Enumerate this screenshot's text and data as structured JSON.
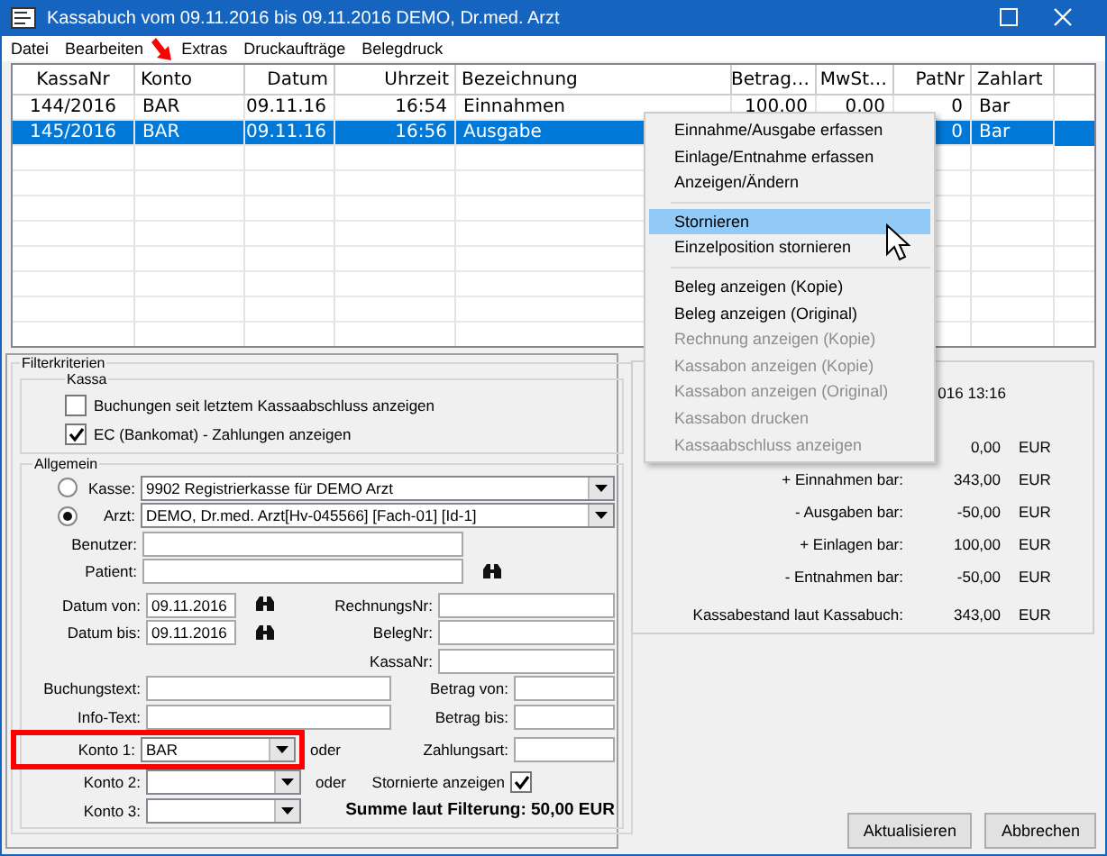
{
  "window": {
    "title": "Kassabuch vom 09.11.2016 bis 09.11.2016 DEMO, Dr.med. Arzt"
  },
  "menu": [
    "Datei",
    "Bearbeiten",
    "Extras",
    "Druckaufträge",
    "Belegdruck"
  ],
  "table": {
    "columns": [
      "KassaNr",
      "Konto",
      "Datum",
      "Uhrzeit",
      "Bezeichnung",
      "Betrag…",
      "MwSt…",
      "PatNr",
      "Zahlart"
    ],
    "rows": [
      {
        "selected": false,
        "cells": [
          "144/2016",
          "BAR",
          "09.11.16",
          "16:54",
          "Einnahmen",
          "100,00",
          "0,00",
          "0",
          "Bar"
        ]
      },
      {
        "selected": true,
        "cells": [
          "145/2016",
          "BAR",
          "09.11.16",
          "16:56",
          "Ausgabe",
          null,
          null,
          "0",
          "Bar"
        ]
      }
    ]
  },
  "context_menu": {
    "groups": [
      [
        {
          "label": "Einnahme/Ausgabe erfassen",
          "disabled": false,
          "selected": false
        },
        {
          "label": "Einlage/Entnahme erfassen",
          "disabled": false,
          "selected": false
        },
        {
          "label": "Anzeigen/Ändern",
          "disabled": false,
          "selected": false
        }
      ],
      [
        {
          "label": "Stornieren",
          "disabled": false,
          "selected": true
        },
        {
          "label": "Einzelposition stornieren",
          "disabled": false,
          "selected": false
        }
      ],
      [
        {
          "label": "Beleg anzeigen (Kopie)",
          "disabled": false,
          "selected": false
        },
        {
          "label": "Beleg anzeigen (Original)",
          "disabled": false,
          "selected": false
        },
        {
          "label": "Rechnung anzeigen (Kopie)",
          "disabled": true,
          "selected": false
        },
        {
          "label": "Kassabon anzeigen (Kopie)",
          "disabled": true,
          "selected": false
        },
        {
          "label": "Kassabon anzeigen (Original)",
          "disabled": true,
          "selected": false
        },
        {
          "label": "Kassabon drucken",
          "disabled": true,
          "selected": false
        },
        {
          "label": "Kassaabschluss anzeigen",
          "disabled": true,
          "selected": false
        }
      ]
    ]
  },
  "filter": {
    "title": "Filterkriterien",
    "kassa": {
      "title": "Kassa",
      "options": [
        {
          "label": "Buchungen seit letztem Kassaabschluss anzeigen",
          "checked": false
        },
        {
          "label": "EC (Bankomat) - Zahlungen anzeigen",
          "checked": true
        }
      ]
    },
    "allgemein": {
      "title": "Allgemein",
      "sources": [
        {
          "label": "Kasse:",
          "value": "9902  Registrierkasse für DEMO Arzt",
          "selected": false
        },
        {
          "label": "Arzt:",
          "value": "DEMO, Dr.med. Arzt[Hv-045566] [Fach-01] [Id-1]",
          "selected": true
        }
      ],
      "benutzer": {
        "label": "Benutzer:"
      },
      "patient": {
        "label": "Patient:"
      },
      "left": [
        {
          "kind": "date",
          "label": "Datum von:",
          "value": "09.11.2016"
        },
        {
          "kind": "date",
          "label": "Datum bis:",
          "value": "09.11.2016"
        },
        {
          "kind": "empty"
        },
        {
          "kind": "text",
          "label": "Buchungstext:"
        },
        {
          "kind": "text",
          "label": "Info-Text:"
        },
        {
          "kind": "combo",
          "label": "Konto 1:",
          "value": "BAR",
          "suffix": "oder",
          "highlighted": true
        },
        {
          "kind": "combo",
          "label": "Konto 2:",
          "suffix": "oder",
          "highlighted": false
        },
        {
          "kind": "combo",
          "label": "Konto 3:",
          "highlighted": false
        }
      ],
      "right": [
        {
          "kind": "wide",
          "label": "RechnungsNr:"
        },
        {
          "kind": "wide",
          "label": "BelegNr:"
        },
        {
          "kind": "wide",
          "label": "KassaNr:"
        },
        {
          "kind": "narrow",
          "label": "Betrag von:"
        },
        {
          "kind": "narrow",
          "label": "Betrag bis:"
        },
        {
          "kind": "narrow",
          "label": "Zahlungsart:"
        },
        {
          "kind": "check",
          "label": "Stornierte anzeigen",
          "checked": true
        },
        {
          "kind": "total",
          "label": "Summe laut Filterung: 50,00 EUR"
        }
      ]
    }
  },
  "summary": {
    "header": "016 13:16",
    "rows": [
      {
        "amount": "0,00",
        "unit": "EUR"
      },
      {
        "label": "+ Einnahmen bar:",
        "amount": "343,00",
        "unit": "EUR"
      },
      {
        "label": "- Ausgaben bar:",
        "amount": "-50,00",
        "unit": "EUR"
      },
      {
        "label": "+ Einlagen bar:",
        "amount": "100,00",
        "unit": "EUR"
      },
      {
        "label": "- Entnahmen bar:",
        "amount": "-50,00",
        "unit": "EUR"
      },
      {
        "label": "Kassabestand laut Kassabuch:",
        "amount": "343,00",
        "unit": "EUR",
        "kind": "total"
      }
    ]
  },
  "buttons": [
    "Aktualisieren",
    "Abbrechen"
  ]
}
